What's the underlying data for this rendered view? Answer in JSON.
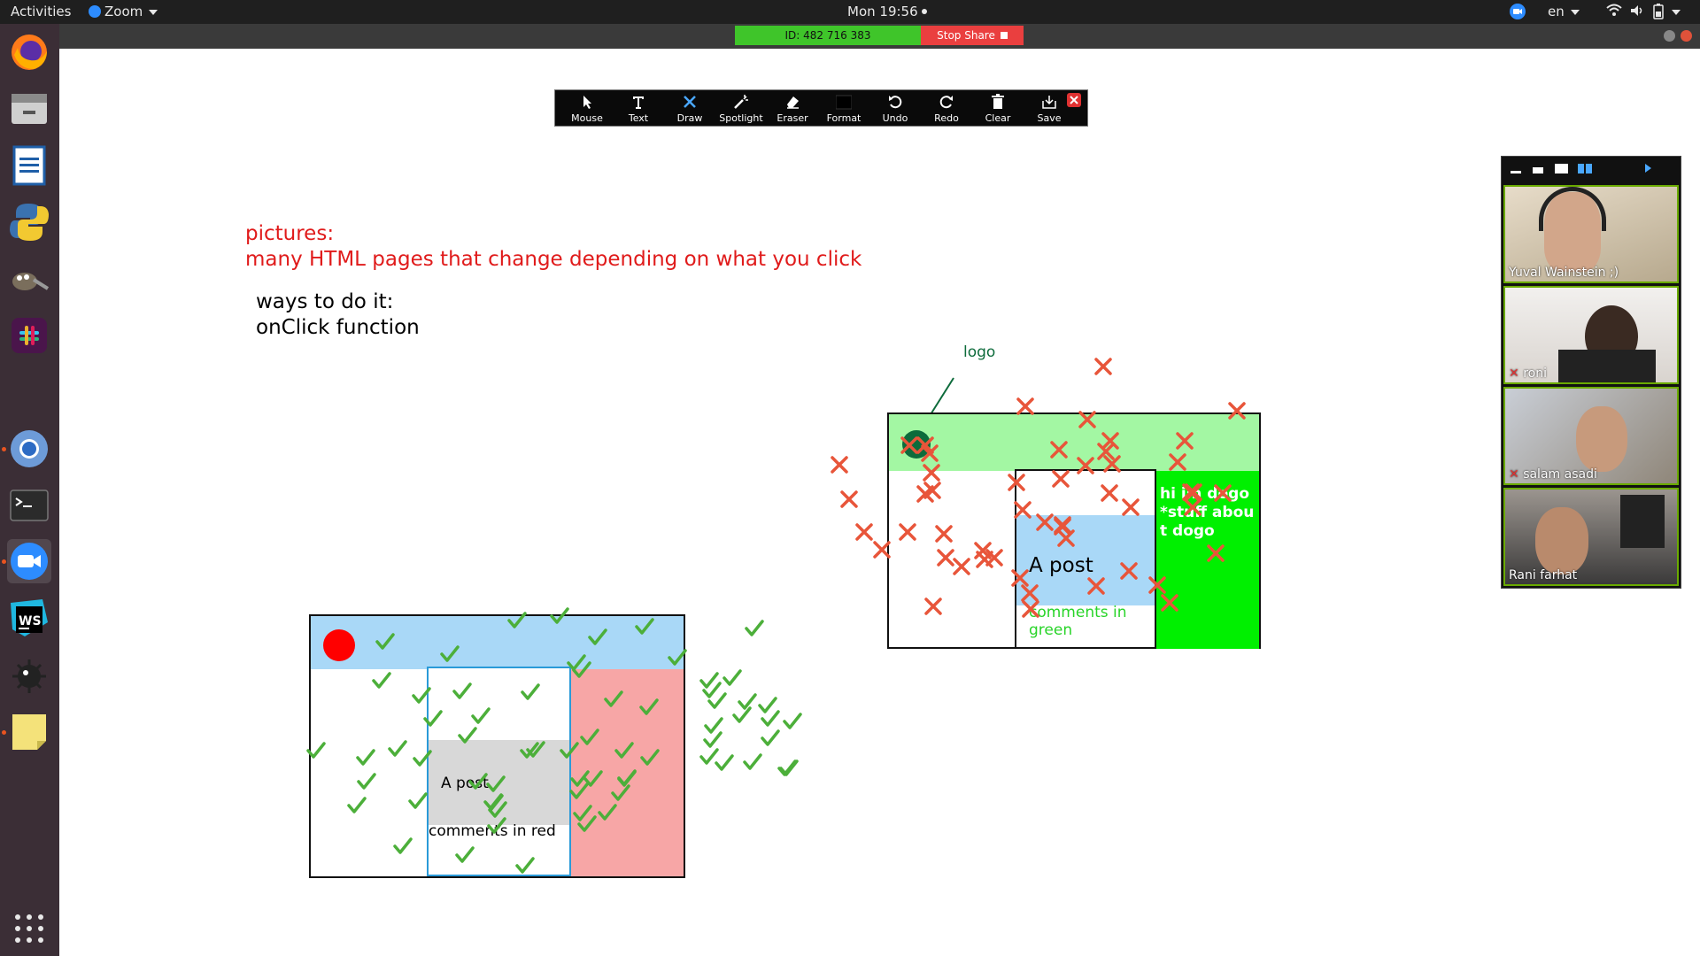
{
  "topbar": {
    "activities": "Activities",
    "app_menu": "Zoom",
    "clock": "Mon 19:56",
    "language": "en"
  },
  "share": {
    "meeting_id": "ID: 482 716 383",
    "stop_share": "Stop Share"
  },
  "dock": {
    "apps": [
      "firefox-icon",
      "files-icon",
      "libreoffice-writer-icon",
      "python-icon",
      "gimp-icon",
      "slack-icon",
      "chromium-icon",
      "terminal-icon",
      "zoom-icon",
      "webstorm-icon",
      "minesweeper-icon",
      "sticky-notes-icon",
      "show-apps-icon"
    ]
  },
  "toolbar": {
    "mouse": "Mouse",
    "text": "Text",
    "draw": "Draw",
    "spotlight": "Spotlight",
    "eraser": "Eraser",
    "format": "Format",
    "undo": "Undo",
    "redo": "Redo",
    "clear": "Clear",
    "save": "Save"
  },
  "whiteboard": {
    "pictures_line1": "pictures:",
    "pictures_line2": "many HTML pages that change depending on what you click",
    "ways_line1": "ways to do it:",
    "ways_line2": "onClick function",
    "logo_label": "logo",
    "green_post": "A post",
    "green_comments": "comments in green",
    "green_sidebar": "hi im dogo *stuff about dogo",
    "red_post": "A post",
    "red_comments": "comments in red"
  },
  "participants": [
    {
      "name": "Yuval Wainstein ;)",
      "muted": false
    },
    {
      "name": "roni",
      "muted": true
    },
    {
      "name": "salam asadi",
      "muted": true
    },
    {
      "name": "Rani farhat",
      "muted": false
    }
  ],
  "colors": {
    "ink_red": "#e01b1b",
    "ink_green_dark": "#0d6b3b",
    "cross": "#e8553a",
    "check": "#4caf3a",
    "header_green": "#a3f7a3",
    "sidebar_green": "#00f000",
    "header_blue": "#a9d8f7",
    "sidebar_pink": "#f7a6a6",
    "post_gray": "#d8d8d8"
  }
}
